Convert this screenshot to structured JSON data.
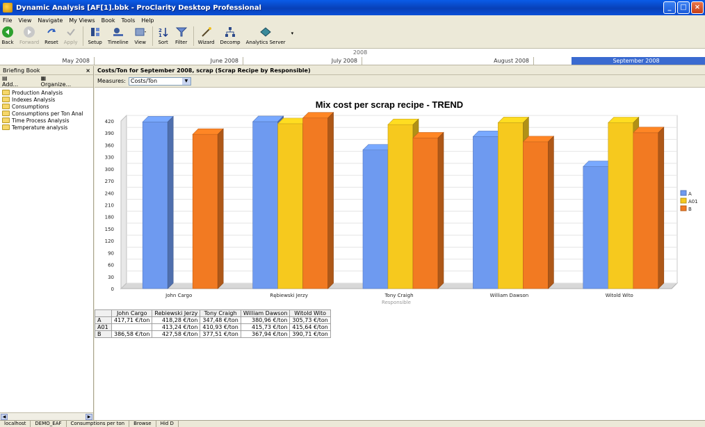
{
  "window": {
    "title": "Dynamic Analysis [AF[1].bbk - ProClarity Desktop Professional"
  },
  "menu": [
    "File",
    "View",
    "Navigate",
    "My Views",
    "Book",
    "Tools",
    "Help"
  ],
  "toolbar": {
    "back": "Back",
    "forward": "Forward",
    "reset": "Reset",
    "apply": "Apply",
    "setup": "Setup",
    "timeline": "Timeline",
    "view": "View",
    "sort": "Sort",
    "filter": "Filter",
    "wizard": "Wizard",
    "decomp": "Decomp",
    "analytics_server": "Analytics Server"
  },
  "timeline": {
    "year": "2008",
    "months": [
      "May 2008",
      "June 2008",
      "July 2008",
      "August 2008",
      "September 2008"
    ],
    "selected": "September 2008"
  },
  "briefing_book": {
    "title": "Briefing Book",
    "close": "×",
    "add": "Add...",
    "organize": "Organize...",
    "folders": [
      "Production Analysis",
      "Indexes Analysis",
      "Consumptions",
      "Consumptions per Ton Anal",
      "Time Process Analysis",
      "Temperature analysis"
    ]
  },
  "view": {
    "title": "Costs/Ton for September 2008, scrap (Scrap Recipe by Responsible)",
    "measures_label": "Measures:",
    "measures_value": "Costs/Ton"
  },
  "chart_data": {
    "type": "bar",
    "title": "Mix cost per scrap recipe - TREND",
    "xlabel": "Responsible",
    "ylabel": "",
    "ylim": [
      0,
      420
    ],
    "yticks": [
      0,
      30,
      60,
      90,
      120,
      150,
      180,
      210,
      240,
      270,
      300,
      330,
      360,
      390,
      420
    ],
    "categories": [
      "John Cargo",
      "Rębiewski Jerzy",
      "Tony Craigh",
      "William Dawson",
      "Witold Wito"
    ],
    "series": [
      {
        "name": "A",
        "values": [
          417.71,
          418.28,
          347.48,
          380.96,
          305.73
        ]
      },
      {
        "name": "A01",
        "values": [
          null,
          413.24,
          410.93,
          415.73,
          415.64
        ]
      },
      {
        "name": "B",
        "values": [
          386.58,
          427.58,
          377.51,
          367.94,
          390.71
        ]
      }
    ],
    "colors": {
      "A": "#6e9af0",
      "A01": "#f6c91e",
      "B": "#f27a22"
    },
    "legend": "right"
  },
  "grid": {
    "headers": [
      "",
      "John Cargo",
      "Rebiewski Jerzy",
      "Tony Craigh",
      "William Dawson",
      "Witold Wito"
    ],
    "rows": [
      [
        "A",
        "417,71 €/ton",
        "418,28 €/ton",
        "347,48 €/ton",
        "380,96 €/ton",
        "305,73 €/ton"
      ],
      [
        "A01",
        "",
        "413,24 €/ton",
        "410,93 €/ton",
        "415,73 €/ton",
        "415,64 €/ton"
      ],
      [
        "B",
        "386,58 €/ton",
        "427,58 €/ton",
        "377,51 €/ton",
        "367,94 €/ton",
        "390,71 €/ton"
      ]
    ]
  },
  "status": [
    "localhost",
    "DEMO_EAF",
    "Consumptions per ton",
    "Browse",
    "Hid D"
  ]
}
